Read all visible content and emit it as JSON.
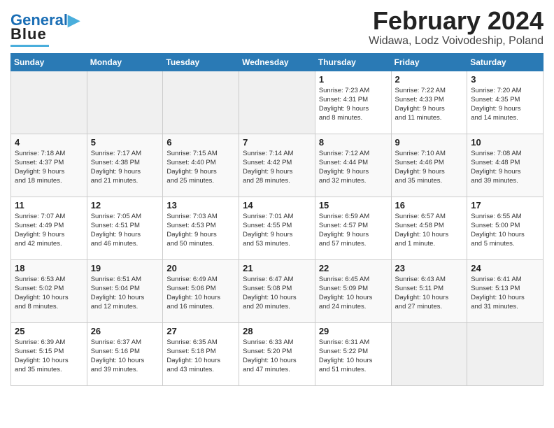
{
  "header": {
    "logo_line1": "General",
    "logo_line2": "Blue",
    "title": "February 2024",
    "subtitle": "Widawa, Lodz Voivodeship, Poland"
  },
  "weekdays": [
    "Sunday",
    "Monday",
    "Tuesday",
    "Wednesday",
    "Thursday",
    "Friday",
    "Saturday"
  ],
  "weeks": [
    [
      {
        "day": "",
        "info": ""
      },
      {
        "day": "",
        "info": ""
      },
      {
        "day": "",
        "info": ""
      },
      {
        "day": "",
        "info": ""
      },
      {
        "day": "1",
        "info": "Sunrise: 7:23 AM\nSunset: 4:31 PM\nDaylight: 9 hours\nand 8 minutes."
      },
      {
        "day": "2",
        "info": "Sunrise: 7:22 AM\nSunset: 4:33 PM\nDaylight: 9 hours\nand 11 minutes."
      },
      {
        "day": "3",
        "info": "Sunrise: 7:20 AM\nSunset: 4:35 PM\nDaylight: 9 hours\nand 14 minutes."
      }
    ],
    [
      {
        "day": "4",
        "info": "Sunrise: 7:18 AM\nSunset: 4:37 PM\nDaylight: 9 hours\nand 18 minutes."
      },
      {
        "day": "5",
        "info": "Sunrise: 7:17 AM\nSunset: 4:38 PM\nDaylight: 9 hours\nand 21 minutes."
      },
      {
        "day": "6",
        "info": "Sunrise: 7:15 AM\nSunset: 4:40 PM\nDaylight: 9 hours\nand 25 minutes."
      },
      {
        "day": "7",
        "info": "Sunrise: 7:14 AM\nSunset: 4:42 PM\nDaylight: 9 hours\nand 28 minutes."
      },
      {
        "day": "8",
        "info": "Sunrise: 7:12 AM\nSunset: 4:44 PM\nDaylight: 9 hours\nand 32 minutes."
      },
      {
        "day": "9",
        "info": "Sunrise: 7:10 AM\nSunset: 4:46 PM\nDaylight: 9 hours\nand 35 minutes."
      },
      {
        "day": "10",
        "info": "Sunrise: 7:08 AM\nSunset: 4:48 PM\nDaylight: 9 hours\nand 39 minutes."
      }
    ],
    [
      {
        "day": "11",
        "info": "Sunrise: 7:07 AM\nSunset: 4:49 PM\nDaylight: 9 hours\nand 42 minutes."
      },
      {
        "day": "12",
        "info": "Sunrise: 7:05 AM\nSunset: 4:51 PM\nDaylight: 9 hours\nand 46 minutes."
      },
      {
        "day": "13",
        "info": "Sunrise: 7:03 AM\nSunset: 4:53 PM\nDaylight: 9 hours\nand 50 minutes."
      },
      {
        "day": "14",
        "info": "Sunrise: 7:01 AM\nSunset: 4:55 PM\nDaylight: 9 hours\nand 53 minutes."
      },
      {
        "day": "15",
        "info": "Sunrise: 6:59 AM\nSunset: 4:57 PM\nDaylight: 9 hours\nand 57 minutes."
      },
      {
        "day": "16",
        "info": "Sunrise: 6:57 AM\nSunset: 4:58 PM\nDaylight: 10 hours\nand 1 minute."
      },
      {
        "day": "17",
        "info": "Sunrise: 6:55 AM\nSunset: 5:00 PM\nDaylight: 10 hours\nand 5 minutes."
      }
    ],
    [
      {
        "day": "18",
        "info": "Sunrise: 6:53 AM\nSunset: 5:02 PM\nDaylight: 10 hours\nand 8 minutes."
      },
      {
        "day": "19",
        "info": "Sunrise: 6:51 AM\nSunset: 5:04 PM\nDaylight: 10 hours\nand 12 minutes."
      },
      {
        "day": "20",
        "info": "Sunrise: 6:49 AM\nSunset: 5:06 PM\nDaylight: 10 hours\nand 16 minutes."
      },
      {
        "day": "21",
        "info": "Sunrise: 6:47 AM\nSunset: 5:08 PM\nDaylight: 10 hours\nand 20 minutes."
      },
      {
        "day": "22",
        "info": "Sunrise: 6:45 AM\nSunset: 5:09 PM\nDaylight: 10 hours\nand 24 minutes."
      },
      {
        "day": "23",
        "info": "Sunrise: 6:43 AM\nSunset: 5:11 PM\nDaylight: 10 hours\nand 27 minutes."
      },
      {
        "day": "24",
        "info": "Sunrise: 6:41 AM\nSunset: 5:13 PM\nDaylight: 10 hours\nand 31 minutes."
      }
    ],
    [
      {
        "day": "25",
        "info": "Sunrise: 6:39 AM\nSunset: 5:15 PM\nDaylight: 10 hours\nand 35 minutes."
      },
      {
        "day": "26",
        "info": "Sunrise: 6:37 AM\nSunset: 5:16 PM\nDaylight: 10 hours\nand 39 minutes."
      },
      {
        "day": "27",
        "info": "Sunrise: 6:35 AM\nSunset: 5:18 PM\nDaylight: 10 hours\nand 43 minutes."
      },
      {
        "day": "28",
        "info": "Sunrise: 6:33 AM\nSunset: 5:20 PM\nDaylight: 10 hours\nand 47 minutes."
      },
      {
        "day": "29",
        "info": "Sunrise: 6:31 AM\nSunset: 5:22 PM\nDaylight: 10 hours\nand 51 minutes."
      },
      {
        "day": "",
        "info": ""
      },
      {
        "day": "",
        "info": ""
      }
    ]
  ]
}
